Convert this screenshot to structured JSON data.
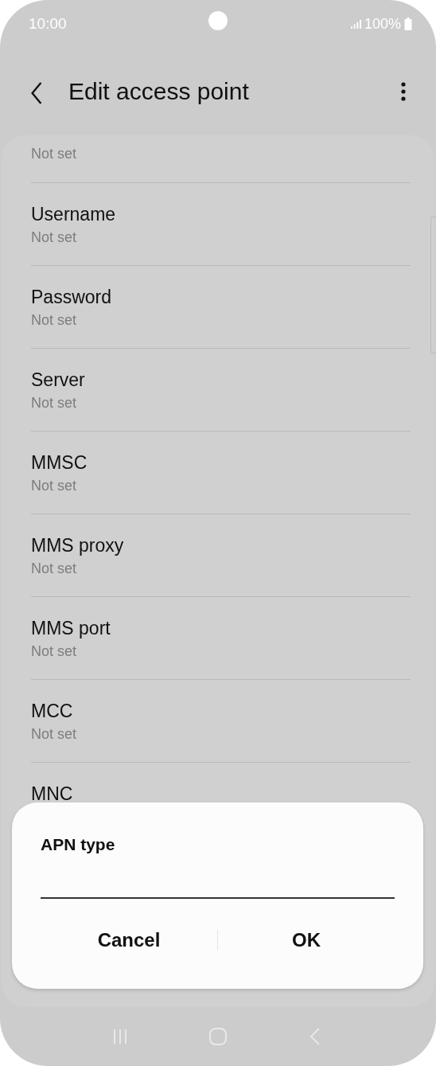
{
  "status_bar": {
    "time": "10:00",
    "battery": "100%"
  },
  "header": {
    "title": "Edit access point"
  },
  "items": [
    {
      "value": "Not set"
    },
    {
      "label": "Username",
      "value": "Not set"
    },
    {
      "label": "Password",
      "value": "Not set"
    },
    {
      "label": "Server",
      "value": "Not set"
    },
    {
      "label": "MMSC",
      "value": "Not set"
    },
    {
      "label": "MMS proxy",
      "value": "Not set"
    },
    {
      "label": "MMS port",
      "value": "Not set"
    },
    {
      "label": "MCC",
      "value": "Not set"
    },
    {
      "label": "MNC"
    }
  ],
  "dialog": {
    "title": "APN type",
    "buttons": [
      "Cancel",
      "OK"
    ]
  }
}
